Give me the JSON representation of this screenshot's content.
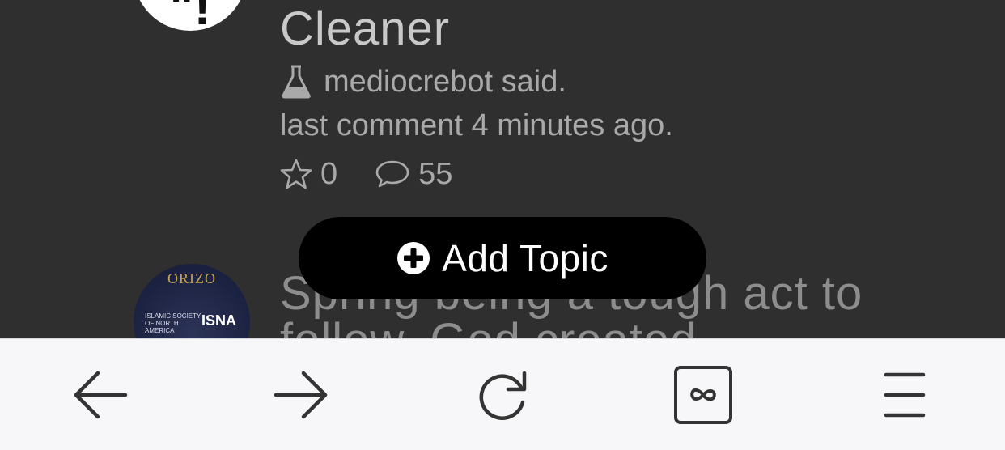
{
  "topics": [
    {
      "avatar_glyph": "\"!",
      "title_visible": "Cleaner",
      "author_text": "mediocrebot said.",
      "last_comment": "last comment 4 minutes ago.",
      "stars": "0",
      "comments": "55"
    },
    {
      "avatar_arc_text": "ORIZO",
      "avatar_org_text": "ISLAMIC SOCIETY OF NORTH AMERICA",
      "avatar_acronym": "ISNA",
      "title_visible": "Spring being a tough act to follow, God created"
    }
  ],
  "add_topic": {
    "label": "Add Topic",
    "icon": "plus-circle-icon"
  },
  "toolbar": {
    "back": {
      "icon": "arrow-left-icon"
    },
    "forward": {
      "icon": "arrow-right-icon"
    },
    "reload": {
      "icon": "reload-icon"
    },
    "tabs": {
      "icon": "infinity-tabs-icon",
      "label": "∞"
    },
    "menu": {
      "icon": "hamburger-menu-icon"
    }
  },
  "colors": {
    "background": "#2f2f2f",
    "title": "#c9c9c9",
    "meta": "#a9a9a9",
    "button": "#000000",
    "toolbar": "#f7f7f9",
    "toolbar_icon": "#333333"
  }
}
